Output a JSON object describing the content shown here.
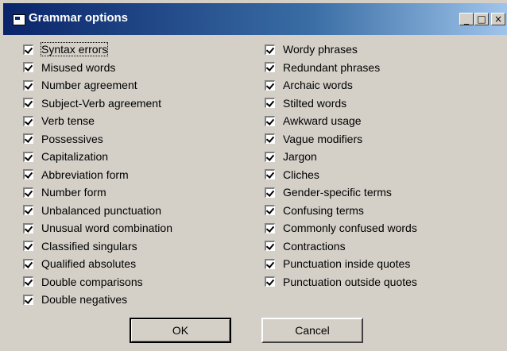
{
  "window": {
    "title": "Grammar options"
  },
  "title_buttons": {
    "minimize": "_",
    "maximize": "□",
    "close": "×"
  },
  "left_options": [
    "Syntax errors",
    "Misused words",
    "Number agreement",
    "Subject-Verb agreement",
    "Verb tense",
    "Possessives",
    "Capitalization",
    "Abbreviation form",
    "Number form",
    "Unbalanced punctuation",
    "Unusual word combination",
    "Classified singulars",
    "Qualified absolutes",
    "Double comparisons",
    "Double negatives"
  ],
  "right_options": [
    "Wordy phrases",
    "Redundant phrases",
    "Archaic words",
    "Stilted words",
    "Awkward usage",
    "Vague modifiers",
    "Jargon",
    "Cliches",
    "Gender-specific terms",
    "Confusing terms",
    "Commonly confused words",
    "Contractions",
    "Punctuation inside quotes",
    "Punctuation outside quotes"
  ],
  "buttons": {
    "ok": "OK",
    "cancel": "Cancel"
  }
}
